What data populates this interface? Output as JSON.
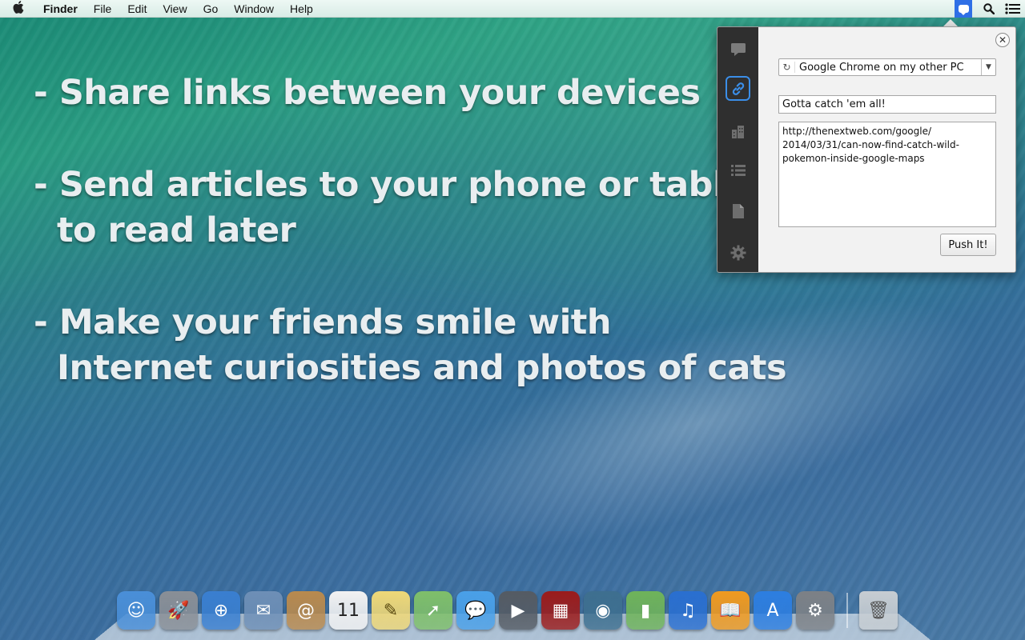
{
  "menubar": {
    "app_name": "Finder",
    "items": [
      "File",
      "Edit",
      "View",
      "Go",
      "Window",
      "Help"
    ],
    "right_icons": [
      "pushbullet-tray-icon",
      "spotlight-search-icon",
      "notification-center-icon"
    ]
  },
  "desktop": {
    "slogans": [
      "- Share links between your devices",
      "- Send articles to your phone or tablet\n  to read later",
      "- Make your friends smile with\n  Internet curiosities and photos of cats"
    ]
  },
  "popup": {
    "sidebar": [
      {
        "icon": "note-icon",
        "active": false
      },
      {
        "icon": "link-icon",
        "active": true
      },
      {
        "icon": "address-icon",
        "active": false
      },
      {
        "icon": "list-icon",
        "active": false
      },
      {
        "icon": "file-icon",
        "active": false
      },
      {
        "icon": "gear-icon",
        "active": false
      }
    ],
    "device_selected": "Google Chrome on my other PC",
    "title_value": "Gotta catch 'em all!",
    "url_value": "http://thenextweb.com/google/\n2014/03/31/can-now-find-catch-wild-\npokemon-inside-google-maps",
    "push_label": "Push It!"
  },
  "dock": {
    "apps": [
      {
        "name": "finder",
        "color": "#4a8fd8",
        "glyph": "☺"
      },
      {
        "name": "launchpad",
        "color": "#8a8f96",
        "glyph": "🚀"
      },
      {
        "name": "safari",
        "color": "#3a7fd0",
        "glyph": "⊕"
      },
      {
        "name": "mail",
        "color": "#6e8fb6",
        "glyph": "✉"
      },
      {
        "name": "contacts",
        "color": "#b98a4e",
        "glyph": "@"
      },
      {
        "name": "calendar",
        "color": "#f2f2f2",
        "glyph": "11",
        "text_color": "#222"
      },
      {
        "name": "notes",
        "color": "#efd878",
        "glyph": "✎",
        "text_color": "#5a4a10"
      },
      {
        "name": "maps",
        "color": "#7fbf6a",
        "glyph": "➚"
      },
      {
        "name": "messages",
        "color": "#4aa0e8",
        "glyph": "💬"
      },
      {
        "name": "facetime",
        "color": "#555b63",
        "glyph": "▶"
      },
      {
        "name": "photo-booth",
        "color": "#9b1c1c",
        "glyph": "▦"
      },
      {
        "name": "iphoto",
        "color": "#3e6f8f",
        "glyph": "◉"
      },
      {
        "name": "numbers",
        "color": "#6fb35a",
        "glyph": "▮"
      },
      {
        "name": "itunes",
        "color": "#2a6fd0",
        "glyph": "♫"
      },
      {
        "name": "ibooks",
        "color": "#f09a20",
        "glyph": "📖"
      },
      {
        "name": "app-store",
        "color": "#2d7ee0",
        "glyph": "A"
      },
      {
        "name": "system-preferences",
        "color": "#7d8186",
        "glyph": "⚙"
      }
    ],
    "trash": {
      "name": "trash",
      "color": "#c7cdd2",
      "glyph": "🗑",
      "text_color": "#555"
    }
  }
}
